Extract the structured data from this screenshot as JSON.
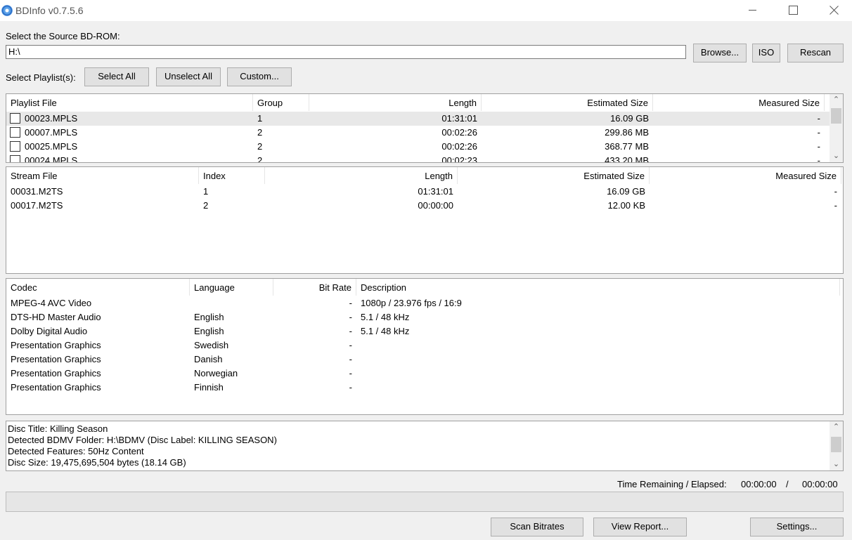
{
  "window": {
    "title": "BDInfo v0.7.5.6"
  },
  "source": {
    "label": "Select the Source BD-ROM:",
    "path": "H:\\",
    "browse_label": "Browse...",
    "iso_label": "ISO",
    "rescan_label": "Rescan"
  },
  "playlist_select": {
    "label": "Select Playlist(s):",
    "select_all_label": "Select All",
    "unselect_all_label": "Unselect All",
    "custom_label": "Custom..."
  },
  "playlists": {
    "columns": [
      "Playlist File",
      "Group",
      "Length",
      "Estimated Size",
      "Measured Size"
    ],
    "rows": [
      {
        "file": "00023.MPLS",
        "group": "1",
        "length": "01:31:01",
        "estimated": "16.09 GB",
        "measured": "-",
        "checked": false
      },
      {
        "file": "00007.MPLS",
        "group": "2",
        "length": "00:02:26",
        "estimated": "299.86 MB",
        "measured": "-",
        "checked": false
      },
      {
        "file": "00025.MPLS",
        "group": "2",
        "length": "00:02:26",
        "estimated": "368.77 MB",
        "measured": "-",
        "checked": false
      },
      {
        "file": "00024.MPLS",
        "group": "2",
        "length": "00:02:23",
        "estimated": "433.20 MB",
        "measured": "-",
        "checked": false
      }
    ]
  },
  "streams": {
    "columns": [
      "Stream File",
      "Index",
      "Length",
      "Estimated Size",
      "Measured Size"
    ],
    "rows": [
      {
        "file": "00031.M2TS",
        "index": "1",
        "length": "01:31:01",
        "estimated": "16.09 GB",
        "measured": "-"
      },
      {
        "file": "00017.M2TS",
        "index": "2",
        "length": "00:00:00",
        "estimated": "12.00 KB",
        "measured": "-"
      }
    ]
  },
  "codecs": {
    "columns": [
      "Codec",
      "Language",
      "Bit Rate",
      "Description"
    ],
    "rows": [
      {
        "codec": "MPEG-4 AVC Video",
        "language": "",
        "bitrate": "-",
        "description": "1080p / 23.976 fps / 16:9"
      },
      {
        "codec": "DTS-HD Master Audio",
        "language": "English",
        "bitrate": "-",
        "description": "5.1 / 48 kHz"
      },
      {
        "codec": "Dolby Digital Audio",
        "language": "English",
        "bitrate": "-",
        "description": "5.1 / 48 kHz"
      },
      {
        "codec": "Presentation Graphics",
        "language": "Swedish",
        "bitrate": "-",
        "description": ""
      },
      {
        "codec": "Presentation Graphics",
        "language": "Danish",
        "bitrate": "-",
        "description": ""
      },
      {
        "codec": "Presentation Graphics",
        "language": "Norwegian",
        "bitrate": "-",
        "description": ""
      },
      {
        "codec": "Presentation Graphics",
        "language": "Finnish",
        "bitrate": "-",
        "description": ""
      }
    ]
  },
  "disc_info": {
    "lines": [
      "Disc Title: Killing Season",
      "Detected BDMV Folder: H:\\BDMV (Disc Label: KILLING SEASON)",
      "Detected Features: 50Hz Content",
      "Disc Size: 19,475,695,504 bytes (18.14 GB)"
    ]
  },
  "status": {
    "time_label": "Time Remaining / Elapsed:",
    "remaining": "00:00:00",
    "separator": "/",
    "elapsed": "00:00:00",
    "progress": 0
  },
  "actions": {
    "scan_bitrates_label": "Scan Bitrates",
    "view_report_label": "View Report...",
    "settings_label": "Settings..."
  },
  "icons": {
    "app": "bluray-disc-icon",
    "minimize": "minimize-icon",
    "maximize": "maximize-icon",
    "close": "close-icon",
    "scroll_up": "chevron-up-icon",
    "scroll_down": "chevron-down-icon"
  }
}
